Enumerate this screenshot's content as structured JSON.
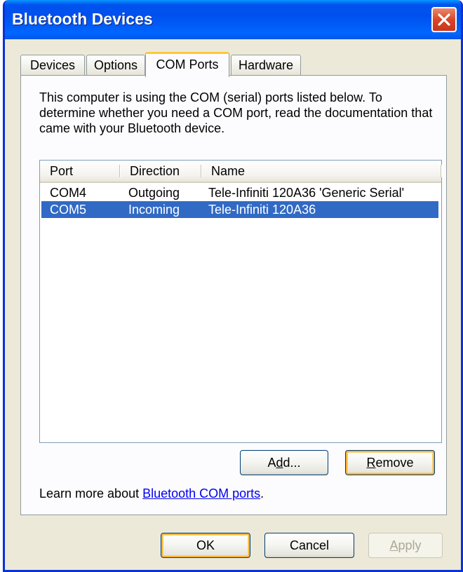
{
  "window": {
    "title": "Bluetooth Devices"
  },
  "tabs": [
    {
      "label": "Devices"
    },
    {
      "label": "Options"
    },
    {
      "label": "COM Ports"
    },
    {
      "label": "Hardware"
    }
  ],
  "description": "This computer is using the COM (serial) ports listed below. To determine whether you need a COM port, read the documentation that came with your Bluetooth device.",
  "ports_list": {
    "columns": [
      "Port",
      "Direction",
      "Name"
    ],
    "rows": [
      {
        "port": "COM4",
        "direction": "Outgoing",
        "name": "Tele-Infiniti 120A36 'Generic Serial'"
      },
      {
        "port": "COM5",
        "direction": "Incoming",
        "name": "Tele-Infiniti 120A36"
      }
    ],
    "selected_row": "COM5"
  },
  "buttons": {
    "add": {
      "pre": "A",
      "key": "d",
      "post": "d..."
    },
    "remove": {
      "pre": "",
      "key": "R",
      "post": "emove"
    },
    "ok": "OK",
    "cancel": "Cancel",
    "apply": {
      "pre": "",
      "key": "A",
      "post": "pply"
    }
  },
  "learn_more": {
    "prefix": "Learn more about ",
    "link": "Bluetooth COM ports",
    "suffix": "."
  },
  "colors": {
    "selection": "#316ac5",
    "title_blue": "#0053ee",
    "focus": "#f8b33a"
  }
}
